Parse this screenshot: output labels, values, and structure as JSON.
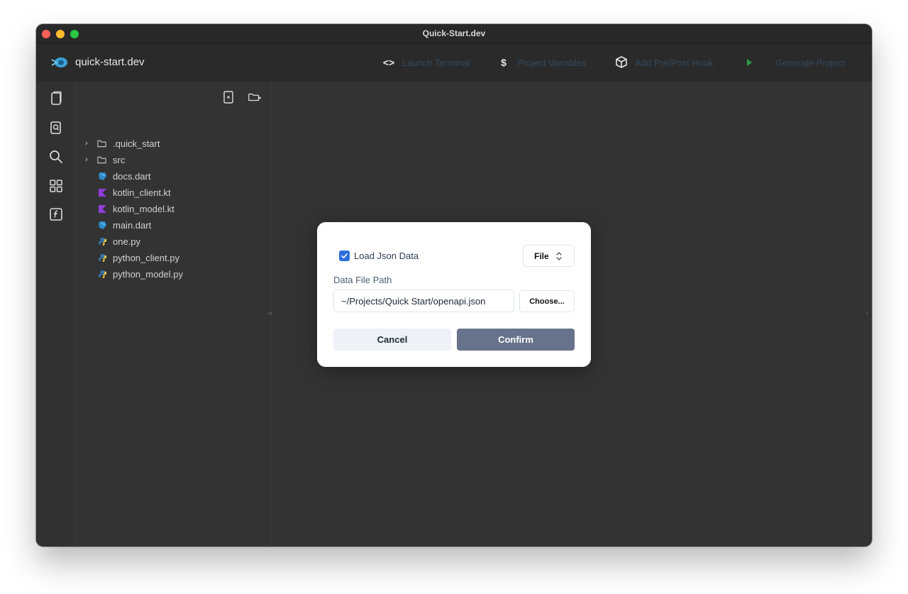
{
  "window": {
    "title": "Quick-Start.dev"
  },
  "toolbar": {
    "app_name": "quick-start.dev",
    "launch_terminal": "Launch Terminal",
    "project_variables": "Project Variables",
    "add_hook": "Add Pre/Post Hook",
    "generate_project": "Generate Project"
  },
  "file_tree": {
    "items": [
      {
        "label": ".quick_start",
        "type": "folder",
        "icon": "folder-icon"
      },
      {
        "label": "src",
        "type": "folder",
        "icon": "folder-icon"
      },
      {
        "label": "docs.dart",
        "type": "file",
        "icon": "dart-icon"
      },
      {
        "label": "kotlin_client.kt",
        "type": "file",
        "icon": "kotlin-icon"
      },
      {
        "label": "kotlin_model.kt",
        "type": "file",
        "icon": "kotlin-icon"
      },
      {
        "label": "main.dart",
        "type": "file",
        "icon": "dart-icon"
      },
      {
        "label": "one.py",
        "type": "file",
        "icon": "python-icon"
      },
      {
        "label": "python_client.py",
        "type": "file",
        "icon": "python-icon"
      },
      {
        "label": "python_model.py",
        "type": "file",
        "icon": "python-icon"
      }
    ]
  },
  "dialog": {
    "checkbox_label": "Load Json Data",
    "checkbox_checked": true,
    "source_select": "File",
    "path_label": "Data File Path",
    "path_value": "~/Projects/Quick Start/openapi.json",
    "choose_label": "Choose...",
    "cancel_label": "Cancel",
    "confirm_label": "Confirm"
  },
  "colors": {
    "accent": "#2f6fdc",
    "confirm": "#67738a",
    "toolbar_label": "#34495e",
    "kotlin": "#8e3dd8",
    "dart": "#2d8bc9",
    "python": "#3776ab"
  }
}
